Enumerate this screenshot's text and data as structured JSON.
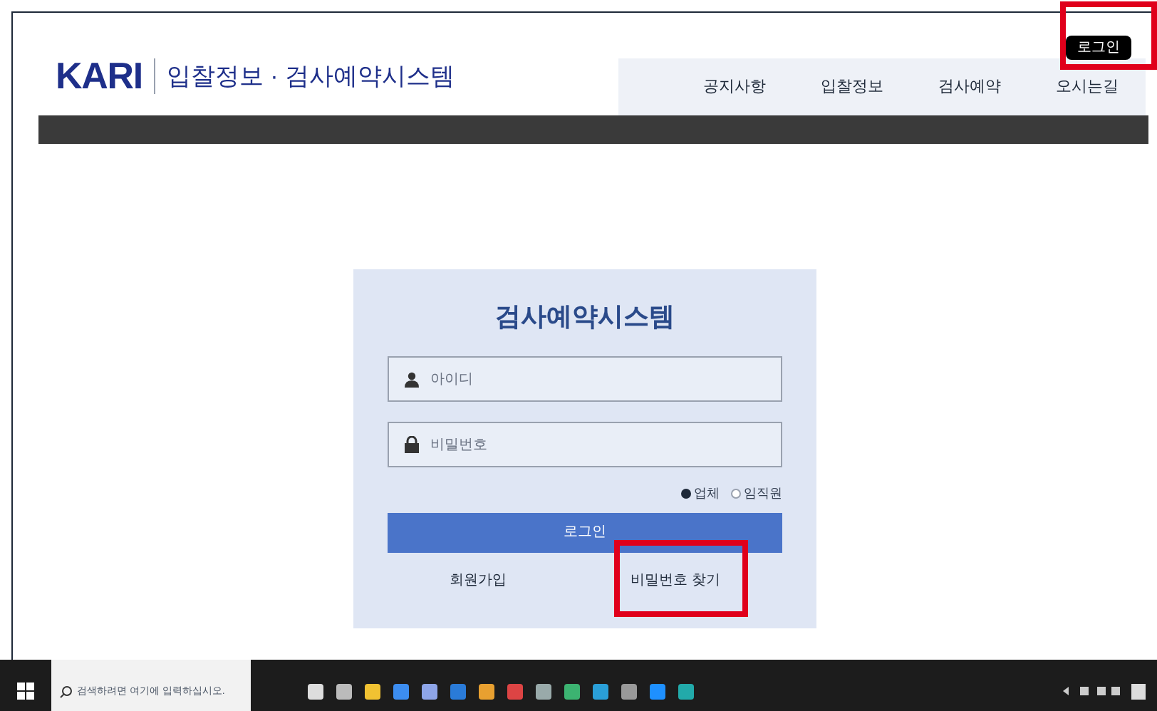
{
  "header": {
    "logo": "KARI",
    "site_title": "입찰정보 · 검사예약시스템",
    "top_login": "로그인",
    "nav": [
      "공지사항",
      "입찰정보",
      "검사예약",
      "오시는길"
    ]
  },
  "login": {
    "title": "검사예약시스템",
    "id_field": {
      "placeholder": "아이디"
    },
    "password_field": {
      "placeholder": "비밀번호"
    },
    "user_types": [
      {
        "label": "업체",
        "selected": true
      },
      {
        "label": "임직원",
        "selected": false
      }
    ],
    "submit": "로그인",
    "links": [
      "회원가입",
      "비밀번호 찾기"
    ]
  },
  "taskbar": {
    "search": {
      "placeholder": "검색하려면 여기에 입력하십시오."
    }
  }
}
